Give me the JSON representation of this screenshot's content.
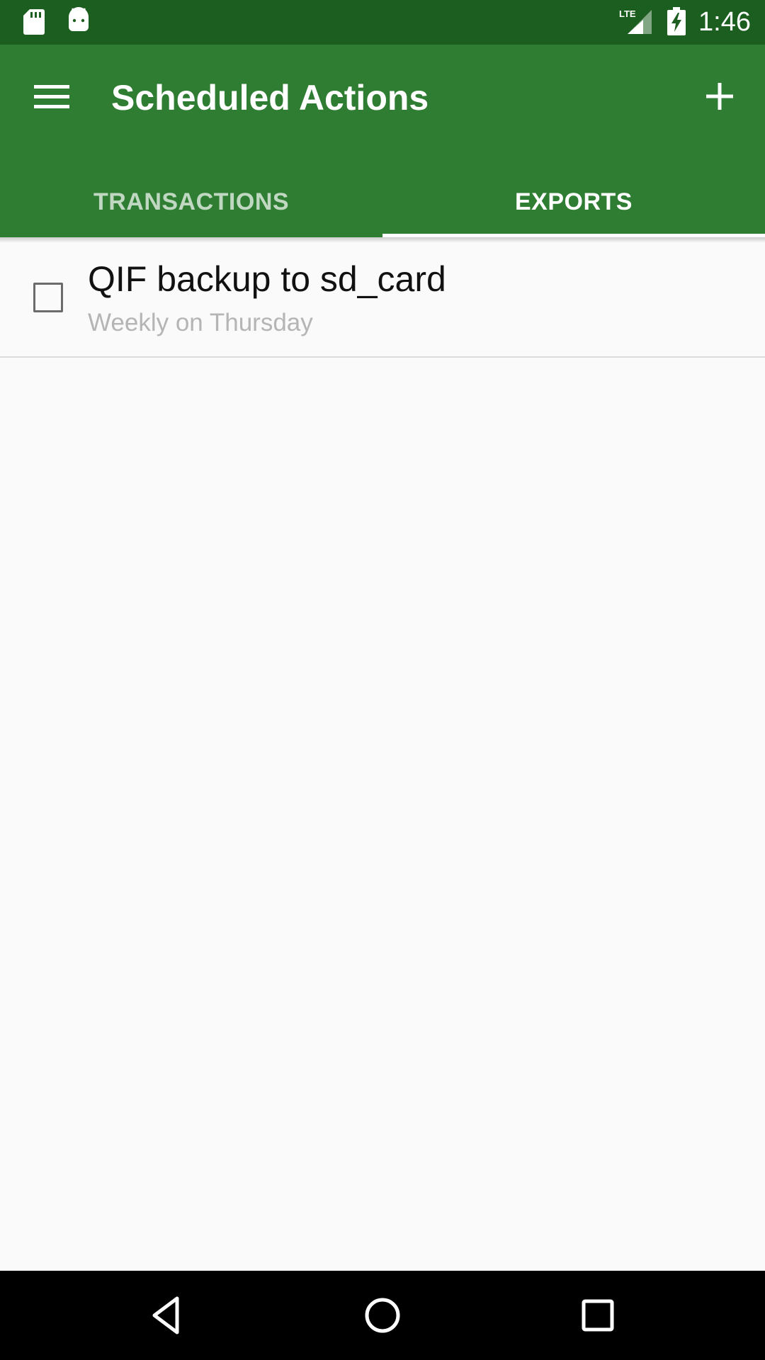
{
  "status_bar": {
    "time": "1:46",
    "network": "LTE",
    "icons": [
      "sd-card-icon",
      "android-icon",
      "lte-signal-icon",
      "battery-charging-icon"
    ]
  },
  "app_bar": {
    "title": "Scheduled Actions",
    "menu_icon": "menu-icon",
    "add_icon": "add-icon"
  },
  "tabs": [
    {
      "label": "TRANSACTIONS",
      "selected": false
    },
    {
      "label": "EXPORTS",
      "selected": true
    }
  ],
  "list": {
    "items": [
      {
        "title": "QIF backup to sd_card",
        "subtitle": "Weekly on Thursday",
        "checked": false
      }
    ]
  },
  "nav_bar": {
    "icons": [
      "back-icon",
      "home-icon",
      "recents-icon"
    ]
  },
  "colors": {
    "status_bar": "#1b5e20",
    "app_bar": "#2e7d32",
    "background": "#fafafa",
    "subtitle": "#b5b5b5"
  }
}
